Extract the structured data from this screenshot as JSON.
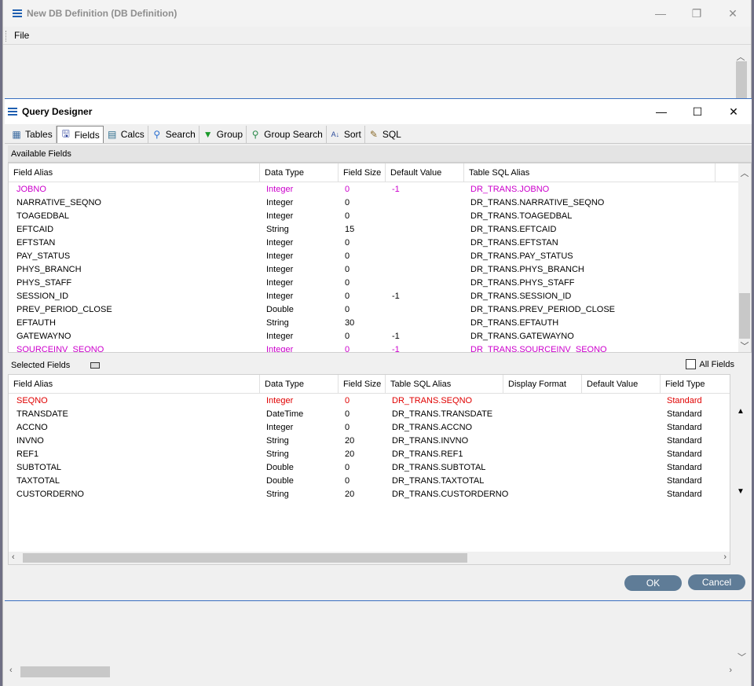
{
  "outer_window": {
    "title": "New DB Definition (DB Definition)",
    "menu": [
      "File"
    ],
    "controls": [
      "—",
      "❐",
      "✕"
    ]
  },
  "query_designer": {
    "title": "Query Designer",
    "controls": [
      "—",
      "☐",
      "✕"
    ],
    "tabs": [
      {
        "label": "Tables",
        "icon": "table-icon"
      },
      {
        "label": "Fields",
        "icon": "save-disk-icon"
      },
      {
        "label": "Calcs",
        "icon": "calculator-icon"
      },
      {
        "label": "Search",
        "icon": "magnifier-icon"
      },
      {
        "label": "Group",
        "icon": "funnel-icon"
      },
      {
        "label": "Group Search",
        "icon": "magnifier-icon"
      },
      {
        "label": "Sort",
        "icon": "sort-az-icon"
      },
      {
        "label": "SQL",
        "icon": "sql-icon"
      }
    ],
    "available_fields": {
      "title": "Available Fields",
      "columns": [
        "Field Alias",
        "Data Type",
        "Field Size",
        "Default Value",
        "Table SQL Alias"
      ],
      "rows": [
        [
          "JOBNO",
          "Integer",
          "0",
          "-1",
          "DR_TRANS.JOBNO"
        ],
        [
          "NARRATIVE_SEQNO",
          "Integer",
          "0",
          "",
          "DR_TRANS.NARRATIVE_SEQNO"
        ],
        [
          "TOAGEDBAL",
          "Integer",
          "0",
          "",
          "DR_TRANS.TOAGEDBAL"
        ],
        [
          "EFTCAID",
          "String",
          "15",
          "",
          "DR_TRANS.EFTCAID"
        ],
        [
          "EFTSTAN",
          "Integer",
          "0",
          "",
          "DR_TRANS.EFTSTAN"
        ],
        [
          "PAY_STATUS",
          "Integer",
          "0",
          "",
          "DR_TRANS.PAY_STATUS"
        ],
        [
          "PHYS_BRANCH",
          "Integer",
          "0",
          "",
          "DR_TRANS.PHYS_BRANCH"
        ],
        [
          "PHYS_STAFF",
          "Integer",
          "0",
          "",
          "DR_TRANS.PHYS_STAFF"
        ],
        [
          "SESSION_ID",
          "Integer",
          "0",
          "-1",
          "DR_TRANS.SESSION_ID"
        ],
        [
          "PREV_PERIOD_CLOSE",
          "Double",
          "0",
          "",
          "DR_TRANS.PREV_PERIOD_CLOSE"
        ],
        [
          "EFTAUTH",
          "String",
          "30",
          "",
          "DR_TRANS.EFTAUTH"
        ],
        [
          "GATEWAYNO",
          "Integer",
          "0",
          "-1",
          "DR_TRANS.GATEWAYNO"
        ],
        [
          "SOURCEINV_SEQNO",
          "Integer",
          "0",
          "-1",
          "DR_TRANS.SOURCEINV_SEQNO"
        ]
      ],
      "highlight_rows": [
        0,
        12
      ],
      "highlight_color": "#cc00cc"
    },
    "selected_fields": {
      "title": "Selected Fields",
      "all_fields_label": "All Fields",
      "columns": [
        "Field Alias",
        "Data Type",
        "Field Size",
        "Table SQL Alias",
        "Display Format",
        "Default Value",
        "Field Type"
      ],
      "rows": [
        [
          "SEQNO",
          "Integer",
          "0",
          "DR_TRANS.SEQNO",
          "",
          "",
          "Standard"
        ],
        [
          "TRANSDATE",
          "DateTime",
          "0",
          "DR_TRANS.TRANSDATE",
          "",
          "",
          "Standard"
        ],
        [
          "ACCNO",
          "Integer",
          "0",
          "DR_TRANS.ACCNO",
          "",
          "",
          "Standard"
        ],
        [
          "INVNO",
          "String",
          "20",
          "DR_TRANS.INVNO",
          "",
          "",
          "Standard"
        ],
        [
          "REF1",
          "String",
          "20",
          "DR_TRANS.REF1",
          "",
          "",
          "Standard"
        ],
        [
          "SUBTOTAL",
          "Double",
          "0",
          "DR_TRANS.SUBTOTAL",
          "",
          "",
          "Standard"
        ],
        [
          "TAXTOTAL",
          "Double",
          "0",
          "DR_TRANS.TAXTOTAL",
          "",
          "",
          "Standard"
        ],
        [
          "CUSTORDERNO",
          "String",
          "20",
          "DR_TRANS.CUSTORDERNO",
          "",
          "",
          "Standard"
        ]
      ],
      "highlight_rows": [
        0
      ],
      "highlight_color": "#e00000"
    },
    "buttons": {
      "ok": "OK",
      "cancel": "Cancel"
    }
  }
}
